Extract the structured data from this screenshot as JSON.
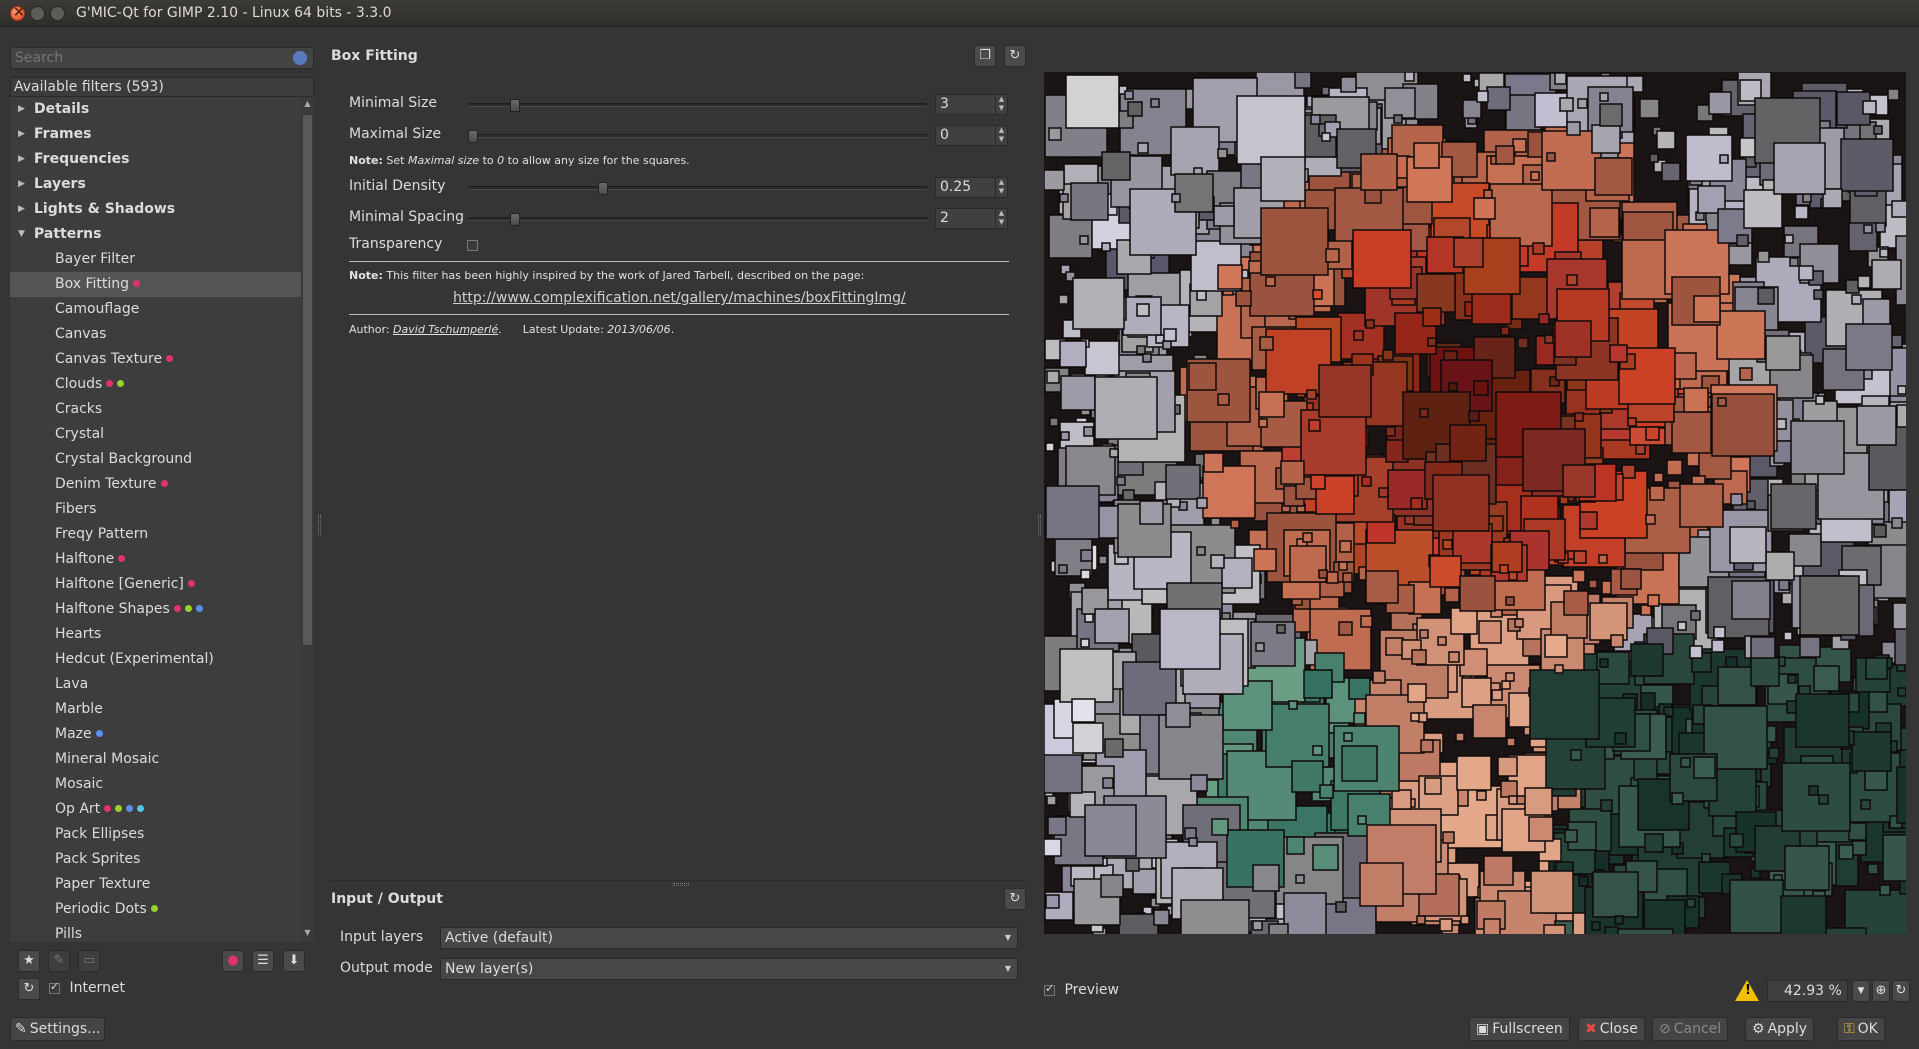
{
  "window": {
    "title": "G'MIC-Qt for GIMP 2.10 - Linux 64 bits - 3.3.0"
  },
  "left": {
    "search_placeholder": "Search",
    "tree_header": "Available filters (593)",
    "tree": [
      {
        "label": "Details",
        "type": "category",
        "expanded": false
      },
      {
        "label": "Frames",
        "type": "category",
        "expanded": false
      },
      {
        "label": "Frequencies",
        "type": "category",
        "expanded": false
      },
      {
        "label": "Layers",
        "type": "category",
        "expanded": false
      },
      {
        "label": "Lights & Shadows",
        "type": "category",
        "expanded": false
      },
      {
        "label": "Patterns",
        "type": "category",
        "expanded": true
      },
      {
        "label": "Bayer Filter",
        "type": "leaf",
        "dots": []
      },
      {
        "label": "Box Fitting",
        "type": "leaf",
        "dots": [
          "#e0336a"
        ],
        "selected": true
      },
      {
        "label": "Camouflage",
        "type": "leaf",
        "dots": []
      },
      {
        "label": "Canvas",
        "type": "leaf",
        "dots": []
      },
      {
        "label": "Canvas Texture",
        "type": "leaf",
        "dots": [
          "#e0336a"
        ]
      },
      {
        "label": "Clouds",
        "type": "leaf",
        "dots": [
          "#e0336a",
          "#9ad12c"
        ]
      },
      {
        "label": "Cracks",
        "type": "leaf",
        "dots": []
      },
      {
        "label": "Crystal",
        "type": "leaf",
        "dots": []
      },
      {
        "label": "Crystal Background",
        "type": "leaf",
        "dots": []
      },
      {
        "label": "Denim Texture",
        "type": "leaf",
        "dots": [
          "#e0336a"
        ]
      },
      {
        "label": "Fibers",
        "type": "leaf",
        "dots": []
      },
      {
        "label": "Freqy Pattern",
        "type": "leaf",
        "dots": []
      },
      {
        "label": "Halftone",
        "type": "leaf",
        "dots": [
          "#e0336a"
        ]
      },
      {
        "label": "Halftone [Generic]",
        "type": "leaf",
        "dots": [
          "#e0336a"
        ]
      },
      {
        "label": "Halftone Shapes",
        "type": "leaf",
        "dots": [
          "#e0336a",
          "#9ad12c",
          "#5b8ff0"
        ]
      },
      {
        "label": "Hearts",
        "type": "leaf",
        "dots": []
      },
      {
        "label": "Hedcut (Experimental)",
        "type": "leaf",
        "dots": []
      },
      {
        "label": "Lava",
        "type": "leaf",
        "dots": []
      },
      {
        "label": "Marble",
        "type": "leaf",
        "dots": []
      },
      {
        "label": "Maze",
        "type": "leaf",
        "dots": [
          "#5b8ff0"
        ]
      },
      {
        "label": "Mineral Mosaic",
        "type": "leaf",
        "dots": []
      },
      {
        "label": "Mosaic",
        "type": "leaf",
        "dots": []
      },
      {
        "label": "Op Art",
        "type": "leaf",
        "dots": [
          "#e0336a",
          "#9ad12c",
          "#5b8ff0",
          "#4ec8e8"
        ]
      },
      {
        "label": "Pack Ellipses",
        "type": "leaf",
        "dots": []
      },
      {
        "label": "Pack Sprites",
        "type": "leaf",
        "dots": []
      },
      {
        "label": "Paper Texture",
        "type": "leaf",
        "dots": []
      },
      {
        "label": "Periodic Dots",
        "type": "leaf",
        "dots": [
          "#9ad12c"
        ]
      },
      {
        "label": "Pills",
        "type": "leaf",
        "dots": []
      }
    ],
    "internet_label": "Internet",
    "internet_checked": true,
    "settings_label": "Settings..."
  },
  "filter": {
    "name": "Box Fitting",
    "params": [
      {
        "label": "Minimal Size",
        "value": "3",
        "level": 0.05
      },
      {
        "label": "Maximal Size",
        "value": "0",
        "level": 0.0
      },
      {
        "label": "Initial Density",
        "value": "0.25",
        "level": 0.25
      },
      {
        "label": "Minimal Spacing",
        "value": "2",
        "level": 0.05
      }
    ],
    "note1_bold": "Note:",
    "note1_a": " Set ",
    "note1_em1": "Maximal size",
    "note1_b": " to ",
    "note1_em2": "0",
    "note1_c": " to allow any size for the squares.",
    "transparency_label": "Transparency",
    "transparency_checked": false,
    "note2_bold": "Note:",
    "note2_text": " This filter has been highly inspired by the work of Jared Tarbell, described on the page:",
    "link": "http://www.complexification.net/gallery/machines/boxFittingImg/",
    "author_prefix": "Author: ",
    "author_name": "David Tschumperlé",
    "author_sep": ".      Latest Update: ",
    "update_date": "2013/06/06",
    "update_suffix": "."
  },
  "io": {
    "title": "Input / Output",
    "input_label": "Input layers",
    "input_value": "Active (default)",
    "output_label": "Output mode",
    "output_value": "New layer(s)"
  },
  "preview": {
    "label": "Preview",
    "checked": true,
    "zoom": "42.93 %",
    "warning": "!"
  },
  "buttons": {
    "fullscreen": "Fullscreen",
    "close": "Close",
    "cancel": "Cancel",
    "apply": "Apply",
    "ok": "OK"
  }
}
